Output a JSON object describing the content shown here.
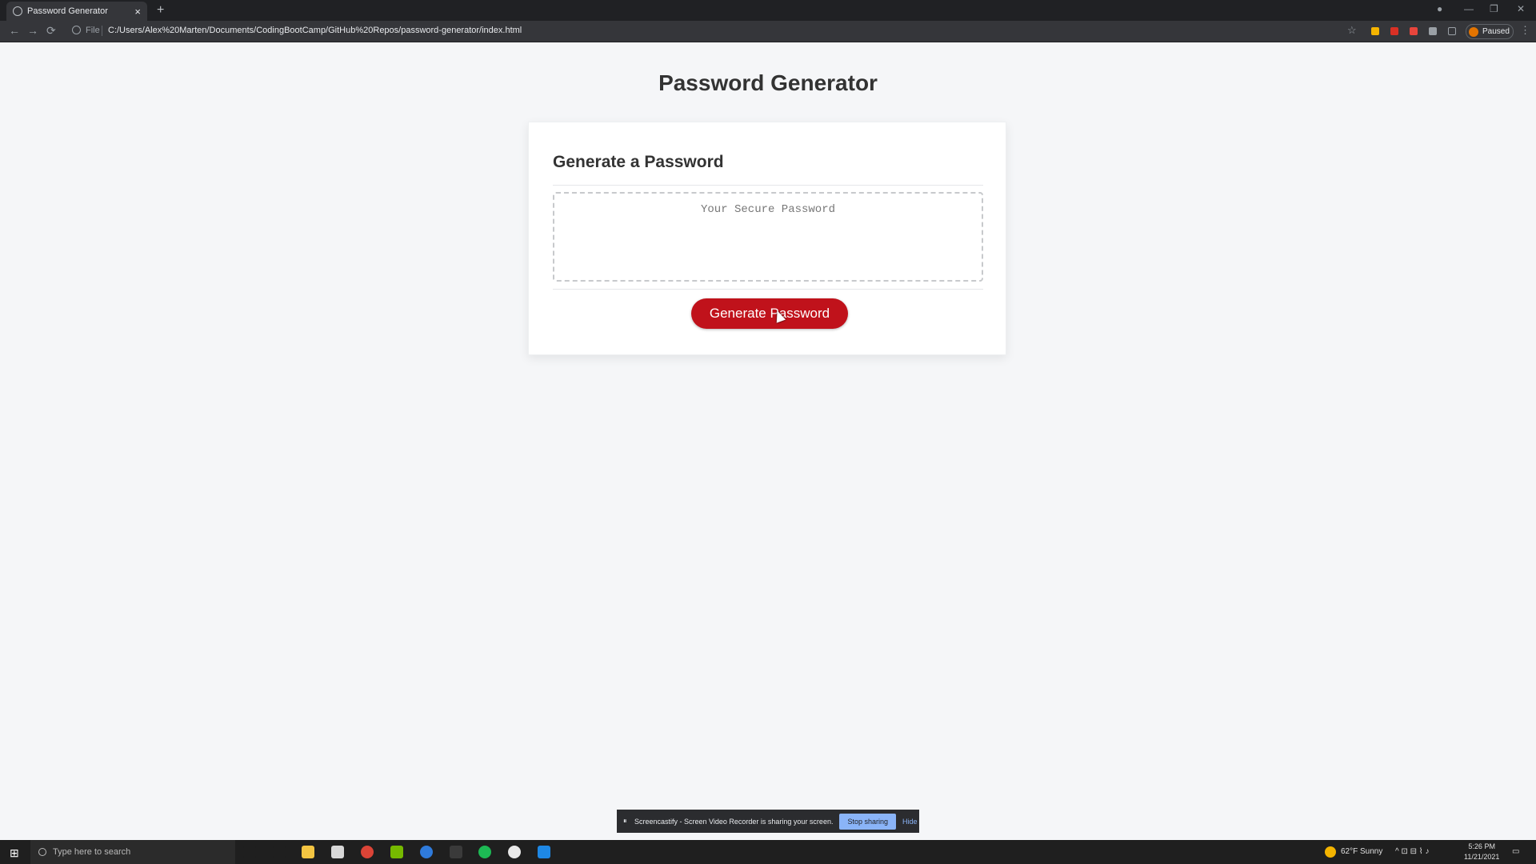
{
  "browser": {
    "tab_title": "Password Generator",
    "tab_close": "×",
    "new_tab": "+",
    "back": "←",
    "forward": "→",
    "reload": "⟳",
    "file_label": "File",
    "url": "C:/Users/Alex%20Marten/Documents/CodingBootCamp/GitHub%20Repos/password-generator/index.html",
    "star": "☆",
    "profile_status": "Paused",
    "menu": "⋮",
    "window_controls": {
      "minimize": "—",
      "maximize": "❐",
      "close": "✕"
    },
    "extension_colors": [
      "#f4b400",
      "#d93025",
      "#e8453c",
      "#9aa0a6"
    ]
  },
  "page": {
    "title": "Password Generator",
    "card_title": "Generate a Password",
    "password_placeholder": "Your Secure Password",
    "generate_button": "Generate Password",
    "accent_color": "#c0121b"
  },
  "share_bar": {
    "pause": "⏸",
    "message": "Screencastify - Screen Video Recorder is sharing your screen.",
    "stop": "Stop sharing",
    "hide": "Hide"
  },
  "taskbar": {
    "start": "⊞",
    "search_placeholder": "Type here to search",
    "weather": "62°F  Sunny",
    "tray_icons": "^  ⊡  ⊟  ⌇  ♪",
    "time": "5:26 PM",
    "date": "11/21/2021",
    "notification": "▭",
    "pinned_apps": [
      {
        "name": "cortana-icon",
        "color": "#1f1f1f"
      },
      {
        "name": "task-view-icon",
        "color": "#1f1f1f"
      },
      {
        "name": "file-explorer-icon",
        "color": "#f4c542"
      },
      {
        "name": "app-icon",
        "color": "#d8d8d8"
      },
      {
        "name": "chrome-icon",
        "color": "#db4437"
      },
      {
        "name": "nvidia-icon",
        "color": "#76b900"
      },
      {
        "name": "app-blue-icon",
        "color": "#2f7bdc"
      },
      {
        "name": "terminal-icon",
        "color": "#3a3a3a"
      },
      {
        "name": "spotify-icon",
        "color": "#1db954"
      },
      {
        "name": "slack-icon",
        "color": "#e8e8e8"
      },
      {
        "name": "vscode-icon",
        "color": "#1e88e5"
      }
    ]
  }
}
